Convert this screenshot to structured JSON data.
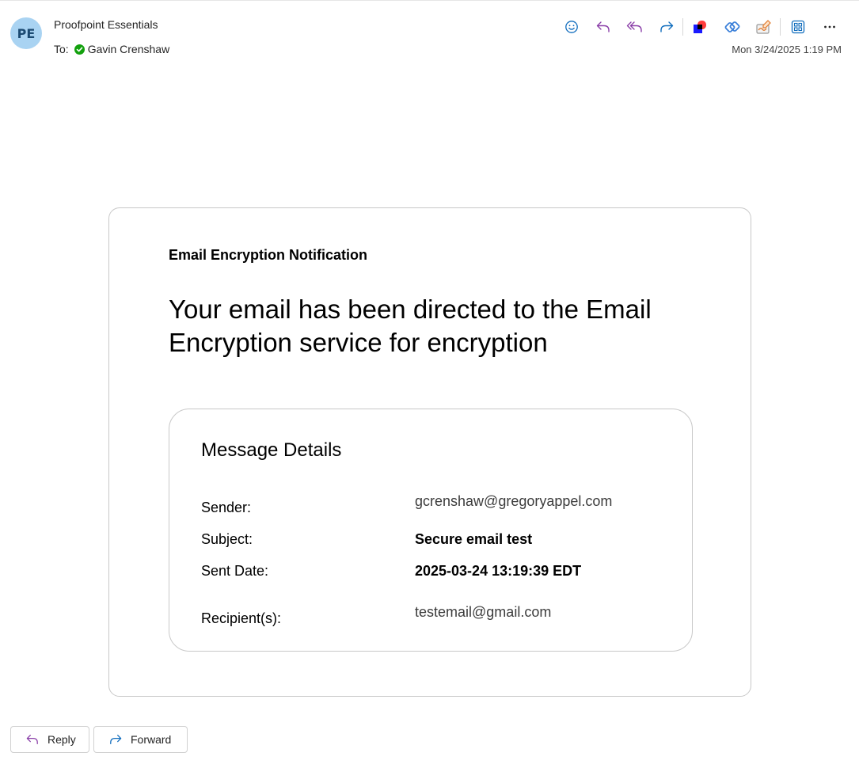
{
  "header": {
    "avatar_initials": "PE",
    "sender_name": "Proofpoint Essentials",
    "to_label": "To:",
    "recipient_name": "Gavin Crenshaw",
    "date": "Mon 3/24/2025 1:19 PM",
    "toolbar_icons": [
      "emoji-icon",
      "reply-icon",
      "reply-all-icon",
      "forward-icon",
      "app-addin-icon",
      "link-addin-icon",
      "signature-addin-icon",
      "apps-grid-icon",
      "more-icon"
    ]
  },
  "body": {
    "notification_label": "Email Encryption Notification",
    "headline": "Your email has been directed to the Email Encryption service for encryption",
    "details": {
      "title": "Message Details",
      "sender_label": "Sender:",
      "sender_value": "gcrenshaw@gregoryappel.com",
      "subject_label": "Subject:",
      "subject_value": "Secure email test",
      "sent_date_label": "Sent Date:",
      "sent_date_value": "2025-03-24 13:19:39 EDT",
      "recipients_label": "Recipient(s):",
      "recipients_value": "testemail@gmail.com"
    }
  },
  "footer": {
    "reply_label": "Reply",
    "forward_label": "Forward"
  },
  "colors": {
    "accent": "#0f6cbd",
    "reply_purple": "#8a3fa8",
    "avatar_bg": "#a9d3f2",
    "presence_green": "#13a10e"
  }
}
